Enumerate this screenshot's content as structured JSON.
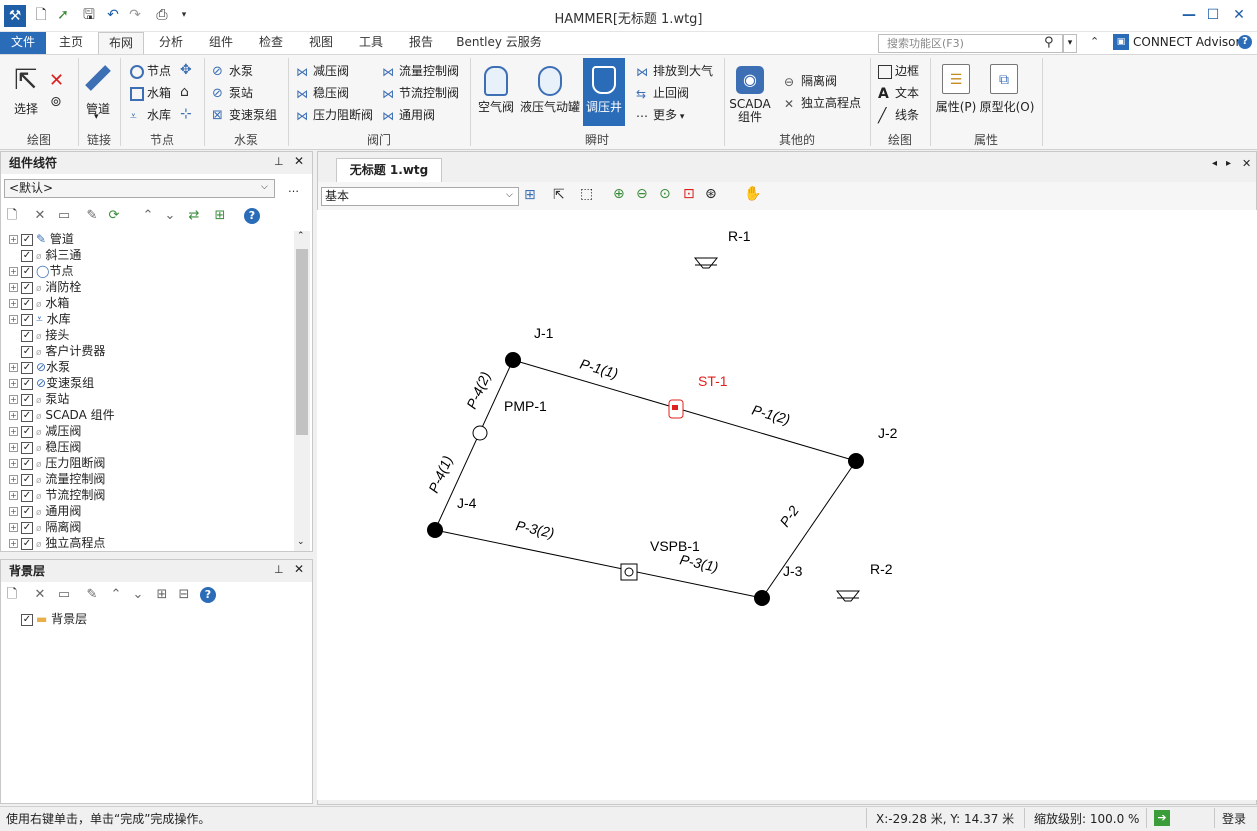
{
  "app": {
    "title": "HAMMER[无标题 1.wtg]"
  },
  "tabs": [
    {
      "label": "文件"
    },
    {
      "label": "主页"
    },
    {
      "label": "布网"
    },
    {
      "label": "分析"
    },
    {
      "label": "组件"
    },
    {
      "label": "检查"
    },
    {
      "label": "视图"
    },
    {
      "label": "工具"
    },
    {
      "label": "报告"
    },
    {
      "label": "Bentley 云服务"
    }
  ],
  "search": {
    "placeholder": "搜索功能区(F3)"
  },
  "connect": {
    "label": "CONNECT Advisor"
  },
  "ribbon": {
    "draw": {
      "select": "选择",
      "group": "绘图"
    },
    "link": {
      "pipe": "管道",
      "group": "链接"
    },
    "node": {
      "items": [
        "节点",
        "水箱",
        "水库"
      ],
      "group": "节点"
    },
    "pump": {
      "items": [
        "水泵",
        "泵站",
        "变速泵组"
      ],
      "group": "水泵"
    },
    "valve": {
      "items": [
        "减压阀",
        "稳压阀",
        "压力阻断阀",
        "流量控制阀",
        "节流控制阀",
        "通用阀"
      ],
      "group": "阀门"
    },
    "transient": {
      "big": [
        "空气阀",
        "液压气动罐",
        "调压井"
      ],
      "small": [
        "排放到大气",
        "止回阀",
        "更多"
      ],
      "group": "瞬时"
    },
    "other": {
      "scada": "SCADA 组件",
      "small": [
        "隔离阀",
        "独立高程点"
      ],
      "group": "其他的"
    },
    "drawing": {
      "small": [
        "边框",
        "文本",
        "线条"
      ],
      "group": "绘图"
    },
    "props": {
      "items": [
        "属性(P)",
        "原型化(O)"
      ],
      "group": "属性"
    }
  },
  "element_panel": {
    "title": "组件线符",
    "dropdown": "<默认>",
    "items": [
      "管道",
      "斜三通",
      "节点",
      "消防栓",
      "水箱",
      "水库",
      "接头",
      "客户计费器",
      "水泵",
      "变速泵组",
      "泵站",
      "SCADA 组件",
      "减压阀",
      "稳压阀",
      "压力阻断阀",
      "流量控制阀",
      "节流控制阀",
      "通用阀",
      "隔离阀",
      "独立高程点"
    ]
  },
  "background_panel": {
    "title": "背景层",
    "items": [
      "背景层"
    ]
  },
  "document": {
    "tab": "无标题 1.wtg",
    "view_select": "基本"
  },
  "network": {
    "labels": {
      "R1": "R-1",
      "R2": "R-2",
      "J1": "J-1",
      "J2": "J-2",
      "J3": "J-3",
      "J4": "J-4",
      "P11": "P-1(1)",
      "P12": "P-1(2)",
      "P2": "P-2",
      "P31": "P-3(1)",
      "P32": "P-3(2)",
      "P41": "P-4(1)",
      "P42": "P-4(2)",
      "PMP1": "PMP-1",
      "ST1": "ST-1",
      "VSPB1": "VSPB-1"
    }
  },
  "status": {
    "hint": "使用右键单击，单击“完成”完成操作。",
    "coords": "X:-29.28 米, Y:  14.37 米",
    "zoom": "缩放级别: 100.0 %",
    "login": "登录"
  },
  "colors": {
    "accent": "#2b6cb8",
    "surge_tank": "#e0201e"
  }
}
